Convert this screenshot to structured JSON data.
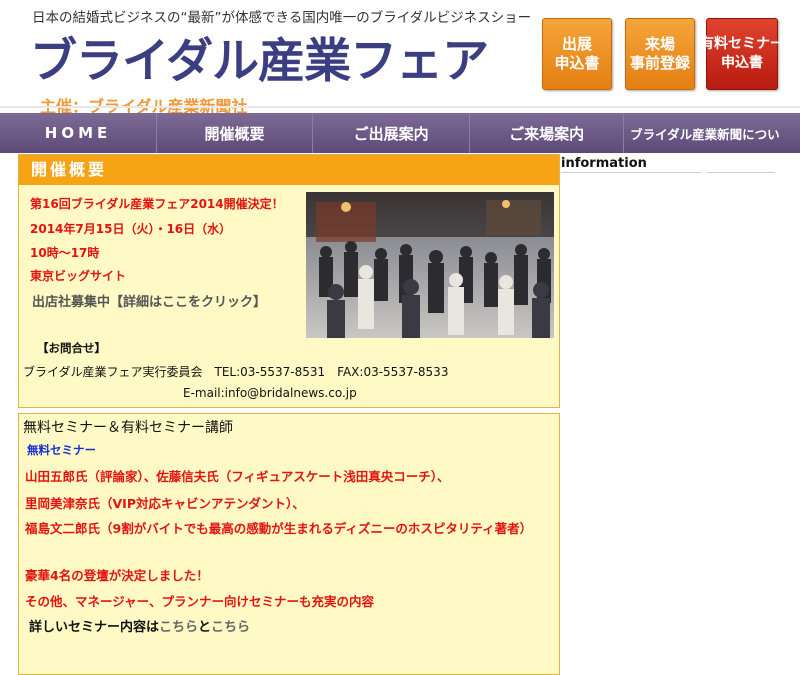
{
  "header": {
    "tagline": "日本の結婚式ビジネスの“最新”が体感できる国内唯一のブライダルビジネスショー",
    "logo": "ブライダル産業フェア",
    "sponsor": "主催：ブライダル産業新聞社",
    "buttons": [
      {
        "line1": "出展",
        "line2": "申込書"
      },
      {
        "line1": "来場",
        "line2": "事前登録"
      },
      {
        "line1": "有料セミナー",
        "line2": "申込書"
      }
    ]
  },
  "nav": {
    "items": [
      "HOME",
      "開催概要",
      "ご出展案内",
      "ご来場案内",
      "ブライダル産業新聞につい"
    ]
  },
  "overview": {
    "heading": "開催概要",
    "event_title": "第16回ブライダル産業フェア2014開催決定！",
    "date": "2014年7月15日（火）・16日（水）",
    "time": "10時～17時",
    "venue": "東京ビッグサイト",
    "exhibitor_recruit": "出店社募集中【詳細はここをクリック】",
    "contact_label": "【お問合せ】",
    "contact_line": "ブライダル産業フェア実行委員会　TEL:03-5537-8531　FAX:03-5537-8533",
    "email": "E-mail:info@bridalnews.co.jp"
  },
  "seminar": {
    "heading": "無料セミナー＆有料セミナー講師",
    "sub_link": "無料セミナー",
    "speakers_1": "山田五郎氏（評論家）、佐藤信夫氏（フィギュアスケート浅田真央コーチ）、",
    "speakers_2": "里岡美津奈氏（VIP対応キャビンアテンダント）、",
    "speakers_3": "福島文二郎氏（9割がバイトでも最高の感動が生まれるディズニーのホスピタリティ著者）",
    "announce": "豪華4名の登壇が決定しました！",
    "more": "その他、マネージャー、プランナー向けセミナーも充実の内容",
    "detail_prefix": "詳しいセミナー内容は",
    "detail_link1": "こちら",
    "detail_mid": "と",
    "detail_link2": "こちら"
  },
  "sidebar": {
    "heading": "information"
  },
  "colors": {
    "nav": "#6b5887",
    "orange_button": "#ee8f22",
    "red_button": "#cc2a1a",
    "box_bg": "#fff9c6",
    "box_head": "#f6a315",
    "red_text": "#e3140e"
  }
}
